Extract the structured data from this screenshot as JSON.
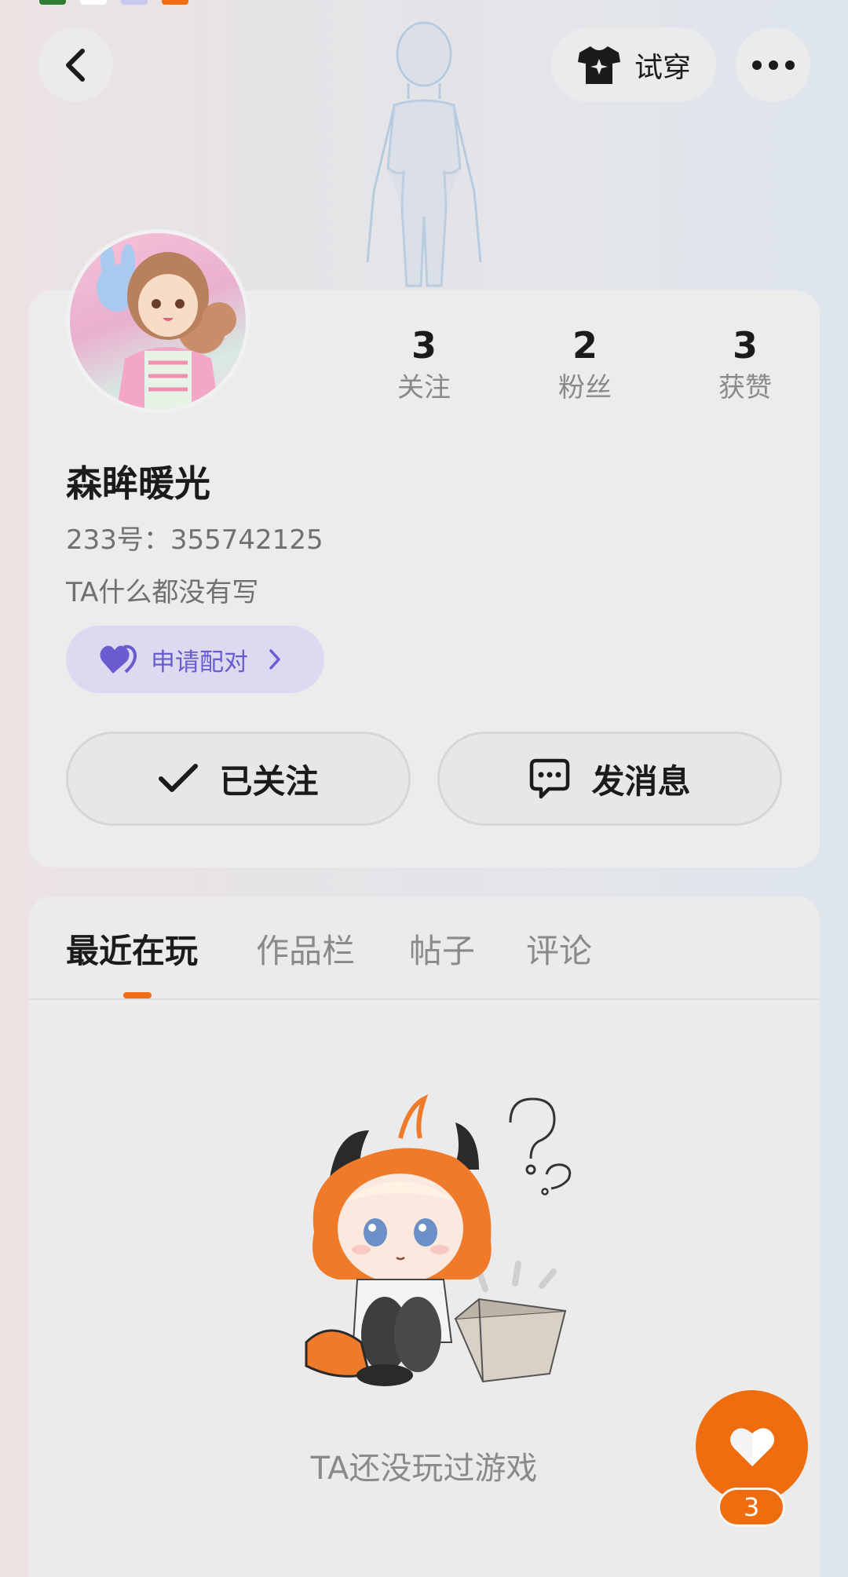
{
  "header": {
    "back_icon": "chevron-left-icon",
    "tryon_icon": "tshirt-sparkle-icon",
    "tryon_label": "试穿",
    "more_icon": "more-dots-icon"
  },
  "profile": {
    "nickname": "森眸暖光",
    "uid": "233号：355742125",
    "bio": "TA什么都没有写",
    "stats": [
      {
        "value": "3",
        "label": "关注"
      },
      {
        "value": "2",
        "label": "粉丝"
      },
      {
        "value": "3",
        "label": "获赞"
      }
    ],
    "pair_label": "申请配对",
    "follow_label": "已关注",
    "message_label": "发消息"
  },
  "tabs": [
    {
      "label": "最近在玩",
      "active": true
    },
    {
      "label": "作品栏",
      "active": false
    },
    {
      "label": "帖子",
      "active": false
    },
    {
      "label": "评论",
      "active": false
    }
  ],
  "empty_state": {
    "text": "TA还没玩过游戏"
  },
  "like_fab": {
    "count": "3"
  },
  "colors": {
    "accent": "#ef6d0e",
    "pair_text": "#6a5bd1",
    "pair_bg": "#dcdaf0"
  }
}
